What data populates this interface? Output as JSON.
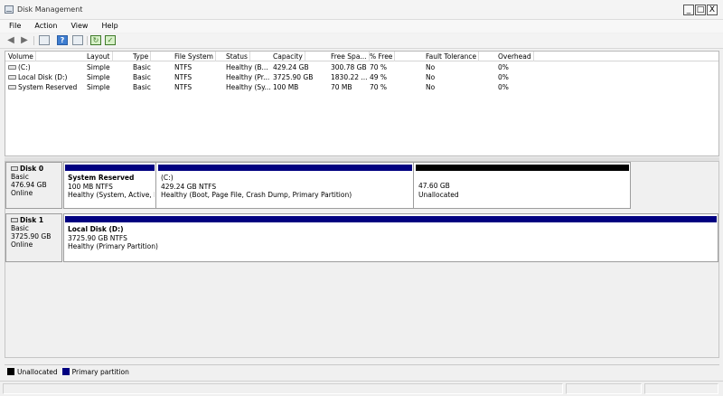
{
  "window": {
    "title": "Disk Management",
    "controls": {
      "minimize": "_",
      "maximize": "□",
      "close": "X"
    }
  },
  "menu": [
    "File",
    "Action",
    "View",
    "Help"
  ],
  "toolbar_icons": [
    "back-arrow-icon",
    "forward-arrow-icon",
    "properties-icon",
    "help-icon",
    "refresh-icon",
    "rescan-icon"
  ],
  "volume_list": {
    "columns": [
      "Volume",
      "Layout",
      "Type",
      "File System",
      "Status",
      "Capacity",
      "Free Spa...",
      "% Free",
      "Fault Tolerance",
      "Overhead"
    ],
    "rows": [
      {
        "volume": "(C:)",
        "layout": "Simple",
        "type": "Basic",
        "fs": "NTFS",
        "status": "Healthy (B...",
        "capacity": "429.24 GB",
        "free": "300.78 GB",
        "pct": "70 %",
        "fault": "No",
        "overhead": "0%"
      },
      {
        "volume": "Local Disk (D:)",
        "layout": "Simple",
        "type": "Basic",
        "fs": "NTFS",
        "status": "Healthy (Pr...",
        "capacity": "3725.90 GB",
        "free": "1830.22 ...",
        "pct": "49 %",
        "fault": "No",
        "overhead": "0%"
      },
      {
        "volume": "System Reserved",
        "layout": "Simple",
        "type": "Basic",
        "fs": "NTFS",
        "status": "Healthy (Sy...",
        "capacity": "100 MB",
        "free": "70 MB",
        "pct": "70 %",
        "fault": "No",
        "overhead": "0%"
      }
    ]
  },
  "disks": [
    {
      "name": "Disk 0",
      "type": "Basic",
      "size": "476.94 GB",
      "state": "Online",
      "partitions": [
        {
          "name": "System Reserved",
          "size": "100 MB NTFS",
          "status": "Healthy (System, Active, Pri",
          "kind": "primary"
        },
        {
          "name": "(C:)",
          "size": "429.24 GB NTFS",
          "status": "Healthy (Boot, Page File, Crash Dump, Primary Partition)",
          "kind": "primary"
        },
        {
          "name": "",
          "size": "47.60 GB",
          "status": "Unallocated",
          "kind": "unallocated"
        }
      ]
    },
    {
      "name": "Disk 1",
      "type": "Basic",
      "size": "3725.90 GB",
      "state": "Online",
      "partitions": [
        {
          "name": "Local Disk  (D:)",
          "size": "3725.90 GB NTFS",
          "status": "Healthy (Primary Partition)",
          "kind": "primary"
        }
      ]
    }
  ],
  "legend": [
    {
      "label": "Unallocated",
      "color": "#000000"
    },
    {
      "label": "Primary partition",
      "color": "#000080"
    }
  ]
}
